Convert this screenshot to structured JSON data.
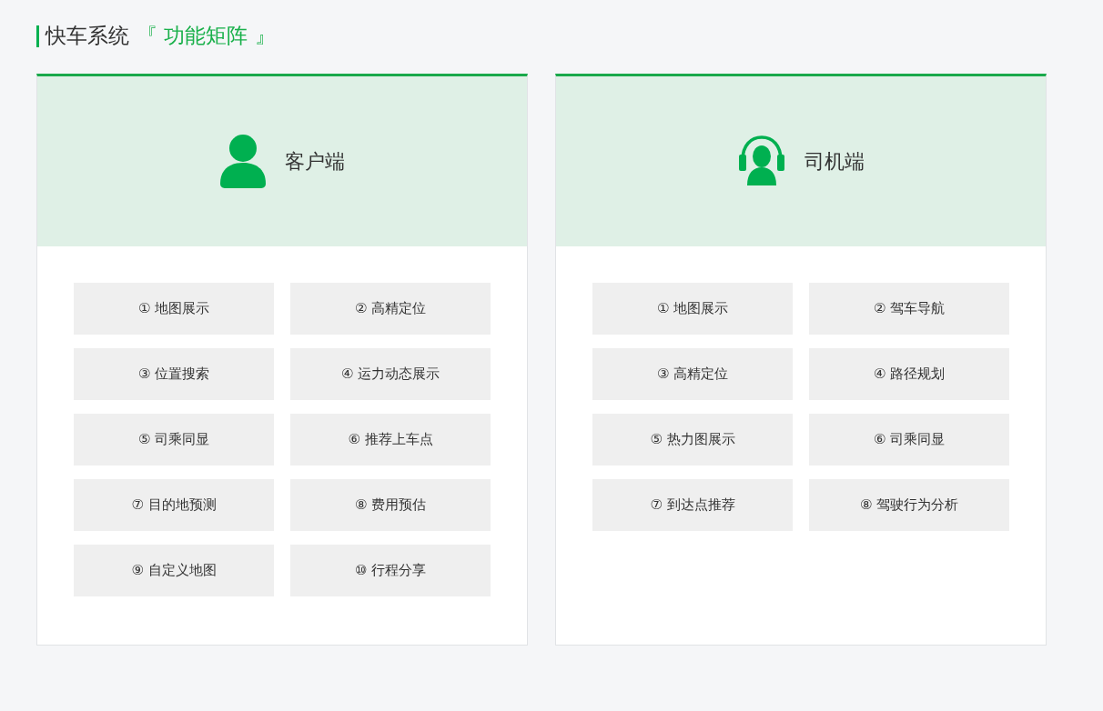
{
  "heading": {
    "title": "快车系统",
    "highlight": "『 功能矩阵 』"
  },
  "panels": [
    {
      "kind": "person",
      "title": "客户端",
      "features": [
        "① 地图展示",
        "② 高精定位",
        "③ 位置搜索",
        "④ 运力动态展示",
        "⑤ 司乘同显",
        "⑥ 推荐上车点",
        "⑦ 目的地预测",
        "⑧ 费用预估",
        "⑨ 自定义地图",
        "⑩ 行程分享"
      ]
    },
    {
      "kind": "headset",
      "title": "司机端",
      "features": [
        "① 地图展示",
        "② 驾车导航",
        "③ 高精定位",
        "④ 路径规划",
        "⑤ 热力图展示",
        "⑥ 司乘同显",
        "⑦ 到达点推荐",
        "⑧ 驾驶行为分析"
      ]
    }
  ]
}
